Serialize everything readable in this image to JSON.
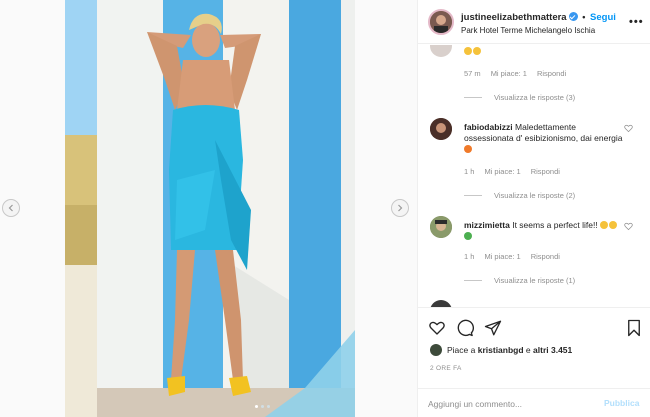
{
  "post": {
    "image_alt": "Donna in abito azzurro davanti a un muro a strisce",
    "carousel_dots": 3
  },
  "header": {
    "username": "justineelizabethmattera",
    "separator": "•",
    "follow_label": "Segui",
    "location": "Park Hotel Terme Michelangelo Ischia",
    "more_icon": "more-horizontal-icon"
  },
  "comments": [
    {
      "username": "",
      "text": "",
      "emojis": [
        "#f5c23b",
        "#f5c23b"
      ],
      "time": "57 m",
      "likes": "Mi piace: 1",
      "reply": "Rispondi",
      "replies": "Visualizza le risposte (3)"
    },
    {
      "username": "fabiodabizzi",
      "text": "Maledettamente ossessionata d' esibizionismo, dai energia",
      "emojis": [
        "#f07a2a"
      ],
      "time": "1 h",
      "likes": "Mi piace: 1",
      "reply": "Rispondi",
      "replies": "Visualizza le risposte (2)"
    },
    {
      "username": "mizzimietta",
      "text": "It seems a perfect life!!",
      "emojis": [
        "#f5c23b",
        "#f5c23b",
        "#4caf50"
      ],
      "time": "1 h",
      "likes": "Mi piace: 1",
      "reply": "Rispondi",
      "replies": "Visualizza le risposte (1)"
    }
  ],
  "actions": {
    "like_icon": "heart-icon",
    "comment_icon": "comment-icon",
    "share_icon": "share-icon",
    "save_icon": "bookmark-icon",
    "likes_prefix": "Piace a ",
    "likes_user": "kristianbgd",
    "likes_suffix": " e ",
    "likes_others": "altri 3.451",
    "time_ago": "2 ORE FA"
  },
  "add_comment": {
    "placeholder": "Aggiungi un commento...",
    "publish_label": "Pubblica"
  },
  "colors": {
    "link": "#0095f6",
    "muted": "#8e8e8e",
    "publish_disabled": "#b2dffc",
    "dress": "#2ab7e0"
  }
}
